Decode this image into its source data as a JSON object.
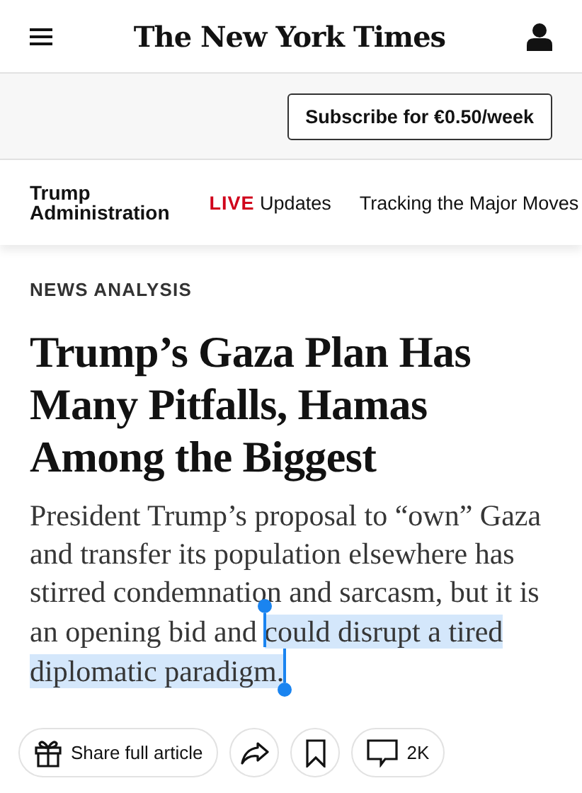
{
  "header": {
    "logo": "The New York Times"
  },
  "subscribe": {
    "label": "Subscribe for €0.50/week"
  },
  "nav": {
    "section": "Trump Administration",
    "links": [
      {
        "kind": "live",
        "badge": "LIVE",
        "label": "Updates"
      },
      {
        "kind": "plain",
        "label": "Tracking the Major Moves"
      }
    ]
  },
  "article": {
    "kicker": "NEWS ANALYSIS",
    "headline": "Trump’s Gaza Plan Has Many Pitfalls, Hamas Among the Biggest",
    "summary": {
      "text": "President Trump’s proposal to “own” Gaza and transfer its population elsewhere has stirred condemnation and sarcasm, but it is an opening bid and ",
      "selected_text": "could disrupt a tired diplomatic paradigm."
    }
  },
  "actions": [
    {
      "kind": "share",
      "label": "Share full article"
    },
    {
      "kind": "forward"
    },
    {
      "kind": "save"
    },
    {
      "kind": "comments",
      "label": "2K"
    }
  ]
}
